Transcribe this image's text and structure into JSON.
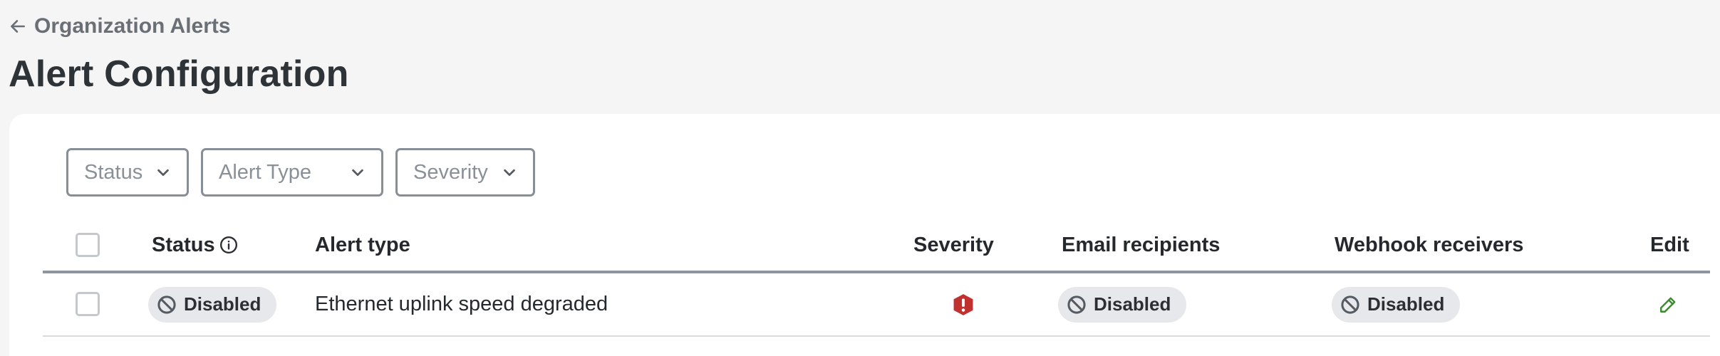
{
  "nav": {
    "back_label": "Organization Alerts"
  },
  "page": {
    "title": "Alert Configuration"
  },
  "filters": {
    "status": "Status",
    "alert_type": "Alert Type",
    "severity": "Severity"
  },
  "table": {
    "headers": {
      "status": "Status",
      "alert_type": "Alert type",
      "severity": "Severity",
      "email": "Email recipients",
      "webhook": "Webhook receivers",
      "edit": "Edit"
    },
    "rows": [
      {
        "status": "Disabled",
        "alert_type": "Ethernet uplink speed degraded",
        "severity_icon": "critical-octagon-icon",
        "email": "Disabled",
        "webhook": "Disabled"
      }
    ]
  },
  "colors": {
    "critical": "#c0312f",
    "edit": "#3a8a2c",
    "pill_bg": "#e6e8eb"
  }
}
